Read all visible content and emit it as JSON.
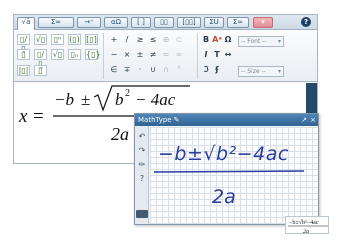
{
  "toolbar": {
    "tabs": [
      "√ā",
      "Σ∞",
      "→⁺",
      "αΩ",
      "[ ]",
      "▯▯",
      "[▯▯]",
      "ΣU",
      "Σ∞"
    ],
    "help_label": "?",
    "templates": [
      "▯/▯",
      "√▯",
      "▯ⁿ",
      "(▯)",
      "[▯]",
      "▯̄",
      "▯/▯",
      "√▯",
      "▯ₙ",
      "{▯}",
      "|▯|",
      "▯⃗"
    ],
    "symbols": [
      "+",
      "/",
      "≥",
      "≤",
      "⊕",
      "−",
      "×",
      "±",
      "≠",
      "≈",
      "∈",
      "∓",
      "·",
      "∪",
      "∩",
      "⊂",
      "∞",
      "°"
    ],
    "font_dropdown": "-- Font --",
    "size_dropdown": "-- Size --",
    "format_buttons": [
      "B",
      "Aᵃ",
      "I",
      "T",
      "Ω",
      "↔",
      "ℑ",
      "ʄ"
    ]
  },
  "document": {
    "equation": {
      "lhs": "x",
      "equals": "=",
      "numerator_neg": "−b",
      "plus_minus": "±",
      "radicand_b": "b",
      "exponent": "2",
      "radicand_rest": "− 4ac",
      "denominator": "2a"
    },
    "scroll_glyph": "ʆ"
  },
  "mathtype_panel": {
    "title": "MathType",
    "title_icon": "✎",
    "window_controls": [
      "↗",
      "×"
    ],
    "tools": [
      "↶",
      "↷",
      "✏",
      "?"
    ],
    "handwriting": {
      "numerator": "−b±√b²−4ac",
      "denominator": "2a"
    },
    "preview": {
      "numerator": "−b±√b²−4ac",
      "denominator": "2a"
    }
  }
}
